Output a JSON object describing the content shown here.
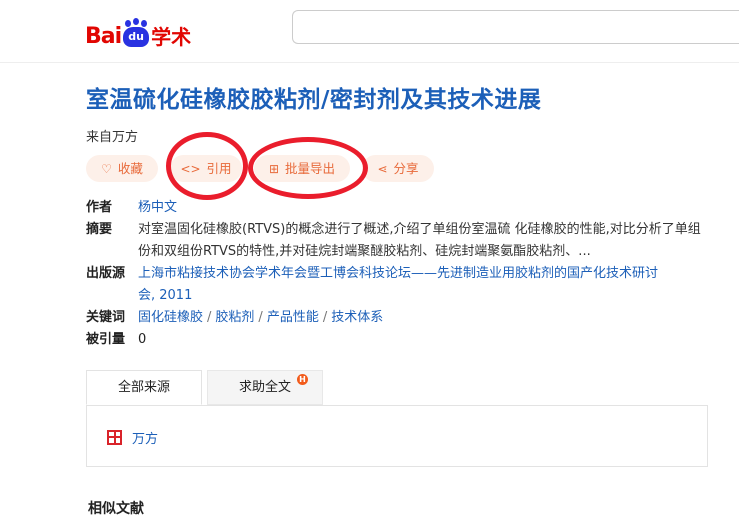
{
  "header": {
    "logo": {
      "part1": "Bai",
      "part2": "du",
      "part3": "学术"
    },
    "search": {
      "value": "",
      "placeholder": ""
    }
  },
  "article": {
    "title": "室温硫化硅橡胶胶粘剂/密封剂及其技术进展",
    "source": "来自万方"
  },
  "actions": [
    {
      "label": "收藏",
      "icon": "heart-icon",
      "glyph": "♡"
    },
    {
      "label": "引用",
      "icon": "code-icon",
      "glyph": "<>"
    },
    {
      "label": "批量导出",
      "icon": "folder-export-icon",
      "glyph": "⊞"
    },
    {
      "label": "分享",
      "icon": "share-icon",
      "glyph": "⋖"
    }
  ],
  "meta": {
    "author_label": "作者",
    "author": "杨中文",
    "abstract_label": "摘要",
    "abstract_line1": "对室温固化硅橡胶(RTVS)的概念进行了概述,介绍了单组份室温硫 化硅橡胶的性能,对比分析了单组",
    "abstract_line2": "份和双组份RTVS的特性,并对硅烷封端聚醚胶粘剂、硅烷封端聚氨酯胶粘剂、...",
    "venue_label": "出版源",
    "venue_line1": "上海市粘接技术协会学术年会暨工博会科技论坛——先进制造业用胶粘剂的国产化技术研讨",
    "venue_line2": "会, 2011",
    "keywords_label": "关键词",
    "keywords": [
      "固化硅橡胶",
      "胶粘剂",
      "产品性能",
      "技术体系"
    ],
    "keyword_separator": "/",
    "cited_label": "被引量",
    "cited": "0"
  },
  "tabs": [
    {
      "label": "全部来源"
    },
    {
      "label": "求助全文",
      "badge": "H"
    }
  ],
  "sources": [
    {
      "label": "万方",
      "icon": "wanfang-icon"
    }
  ],
  "similar_heading": "相似文献",
  "colors": {
    "title": "#1c5fb8",
    "link": "#1c5fb8",
    "button_bg": "#fdf0e9",
    "button_text": "#e86a3a",
    "annotation_ring": "#ea1d2c",
    "brand_red": "#e10602",
    "brand_blue": "#2932e1"
  }
}
